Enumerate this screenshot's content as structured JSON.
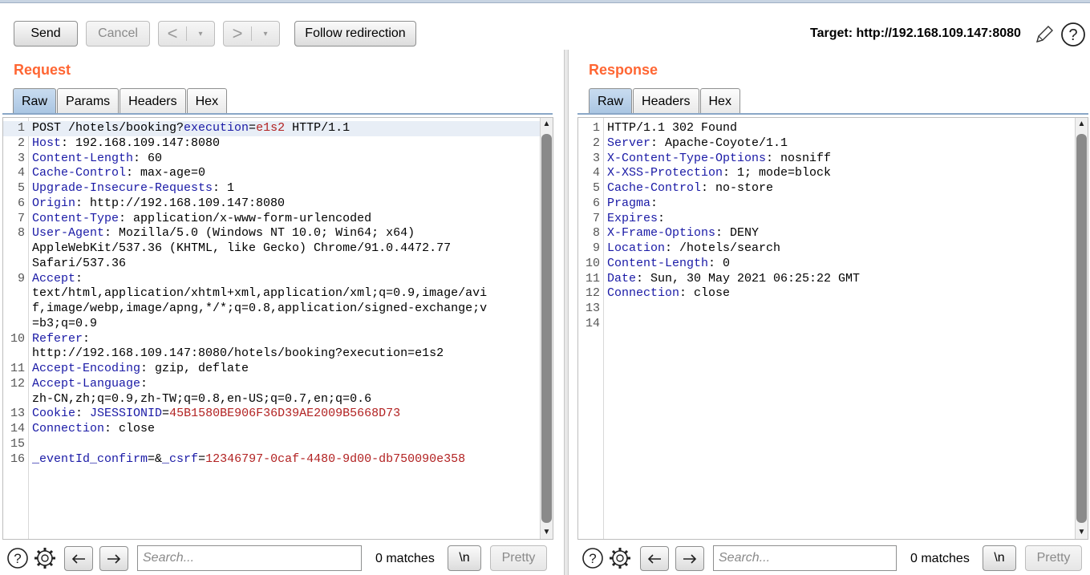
{
  "toolbar": {
    "send_label": "Send",
    "cancel_label": "Cancel",
    "back_arrow": "<",
    "forward_arrow": ">",
    "dropdown_arrow": "▾",
    "follow_label": "Follow redirection",
    "target_label": "Target: http://192.168.109.147:8080",
    "edit_icon": "pencil-icon",
    "help_icon": "help-icon"
  },
  "request": {
    "title": "Request",
    "tabs": [
      "Raw",
      "Params",
      "Headers",
      "Hex"
    ],
    "active_tab": "Raw",
    "lines": [
      {
        "n": "1",
        "segs": [
          [
            "",
            "POST /hotels/booking?"
          ],
          [
            "k",
            "execution"
          ],
          [
            "",
            "="
          ],
          [
            "v",
            "e1s2"
          ],
          [
            "",
            " HTTP/1.1"
          ]
        ]
      },
      {
        "n": "2",
        "segs": [
          [
            "k",
            "Host"
          ],
          [
            "",
            ": 192.168.109.147:8080"
          ]
        ]
      },
      {
        "n": "3",
        "segs": [
          [
            "k",
            "Content-Length"
          ],
          [
            "",
            ": 60"
          ]
        ]
      },
      {
        "n": "4",
        "segs": [
          [
            "k",
            "Cache-Control"
          ],
          [
            "",
            ": max-age=0"
          ]
        ]
      },
      {
        "n": "5",
        "segs": [
          [
            "k",
            "Upgrade-Insecure-Requests"
          ],
          [
            "",
            ": 1"
          ]
        ]
      },
      {
        "n": "6",
        "segs": [
          [
            "k",
            "Origin"
          ],
          [
            "",
            ": http://192.168.109.147:8080"
          ]
        ]
      },
      {
        "n": "7",
        "segs": [
          [
            "k",
            "Content-Type"
          ],
          [
            "",
            ": application/x-www-form-urlencoded"
          ]
        ]
      },
      {
        "n": "8",
        "segs": [
          [
            "k",
            "User-Agent"
          ],
          [
            "",
            ": Mozilla/5.0 (Windows NT 10.0; Win64; x64)"
          ]
        ]
      },
      {
        "n": "",
        "segs": [
          [
            "",
            "AppleWebKit/537.36 (KHTML, like Gecko) Chrome/91.0.4472.77"
          ]
        ]
      },
      {
        "n": "",
        "segs": [
          [
            "",
            "Safari/537.36"
          ]
        ]
      },
      {
        "n": "9",
        "segs": [
          [
            "k",
            "Accept"
          ],
          [
            "",
            ":"
          ]
        ]
      },
      {
        "n": "",
        "segs": [
          [
            "",
            "text/html,application/xhtml+xml,application/xml;q=0.9,image/avi"
          ]
        ]
      },
      {
        "n": "",
        "segs": [
          [
            "",
            "f,image/webp,image/apng,*/*;q=0.8,application/signed-exchange;v"
          ]
        ]
      },
      {
        "n": "",
        "segs": [
          [
            "",
            "=b3;q=0.9"
          ]
        ]
      },
      {
        "n": "10",
        "segs": [
          [
            "k",
            "Referer"
          ],
          [
            "",
            ":"
          ]
        ]
      },
      {
        "n": "",
        "segs": [
          [
            "",
            "http://192.168.109.147:8080/hotels/booking?execution=e1s2"
          ]
        ]
      },
      {
        "n": "11",
        "segs": [
          [
            "k",
            "Accept-Encoding"
          ],
          [
            "",
            ": gzip, deflate"
          ]
        ]
      },
      {
        "n": "12",
        "segs": [
          [
            "k",
            "Accept-Language"
          ],
          [
            "",
            ":"
          ]
        ]
      },
      {
        "n": "",
        "segs": [
          [
            "",
            "zh-CN,zh;q=0.9,zh-TW;q=0.8,en-US;q=0.7,en;q=0.6"
          ]
        ]
      },
      {
        "n": "13",
        "segs": [
          [
            "k",
            "Cookie"
          ],
          [
            "",
            ": "
          ],
          [
            "k",
            "JSESSIONID"
          ],
          [
            "",
            "="
          ],
          [
            "v",
            "45B1580BE906F36D39AE2009B5668D73"
          ]
        ]
      },
      {
        "n": "14",
        "segs": [
          [
            "k",
            "Connection"
          ],
          [
            "",
            ": close"
          ]
        ]
      },
      {
        "n": "15",
        "segs": [
          [
            "",
            ""
          ]
        ]
      },
      {
        "n": "16",
        "segs": [
          [
            "k",
            "_eventId_confirm"
          ],
          [
            "",
            "=&"
          ],
          [
            "k",
            "_csrf"
          ],
          [
            "",
            "="
          ],
          [
            "v",
            "12346797-0caf-4480-9d00-db750090e358"
          ]
        ]
      }
    ],
    "search_placeholder": "Search...",
    "matches": "0 matches",
    "newline_label": "\\n",
    "pretty_label": "Pretty"
  },
  "response": {
    "title": "Response",
    "tabs": [
      "Raw",
      "Headers",
      "Hex"
    ],
    "active_tab": "Raw",
    "lines": [
      {
        "n": "1",
        "segs": [
          [
            "",
            "HTTP/1.1 302 Found"
          ]
        ]
      },
      {
        "n": "2",
        "segs": [
          [
            "k",
            "Server"
          ],
          [
            "",
            ": Apache-Coyote/1.1"
          ]
        ]
      },
      {
        "n": "3",
        "segs": [
          [
            "k",
            "X-Content-Type-Options"
          ],
          [
            "",
            ": nosniff"
          ]
        ]
      },
      {
        "n": "4",
        "segs": [
          [
            "k",
            "X-XSS-Protection"
          ],
          [
            "",
            ": 1; mode=block"
          ]
        ]
      },
      {
        "n": "5",
        "segs": [
          [
            "k",
            "Cache-Control"
          ],
          [
            "",
            ": no-store"
          ]
        ]
      },
      {
        "n": "6",
        "segs": [
          [
            "k",
            "Pragma"
          ],
          [
            "",
            ":"
          ]
        ]
      },
      {
        "n": "7",
        "segs": [
          [
            "k",
            "Expires"
          ],
          [
            "",
            ":"
          ]
        ]
      },
      {
        "n": "8",
        "segs": [
          [
            "k",
            "X-Frame-Options"
          ],
          [
            "",
            ": DENY"
          ]
        ]
      },
      {
        "n": "9",
        "segs": [
          [
            "k",
            "Location"
          ],
          [
            "",
            ": /hotels/search"
          ]
        ]
      },
      {
        "n": "10",
        "segs": [
          [
            "k",
            "Content-Length"
          ],
          [
            "",
            ": 0"
          ]
        ]
      },
      {
        "n": "11",
        "segs": [
          [
            "k",
            "Date"
          ],
          [
            "",
            ": Sun, 30 May 2021 06:25:22 GMT"
          ]
        ]
      },
      {
        "n": "12",
        "segs": [
          [
            "k",
            "Connection"
          ],
          [
            "",
            ": close"
          ]
        ]
      },
      {
        "n": "13",
        "segs": [
          [
            "",
            ""
          ]
        ]
      },
      {
        "n": "14",
        "segs": [
          [
            "",
            ""
          ]
        ]
      }
    ],
    "search_placeholder": "Search...",
    "matches": "0 matches",
    "newline_label": "\\n",
    "pretty_label": "Pretty"
  }
}
